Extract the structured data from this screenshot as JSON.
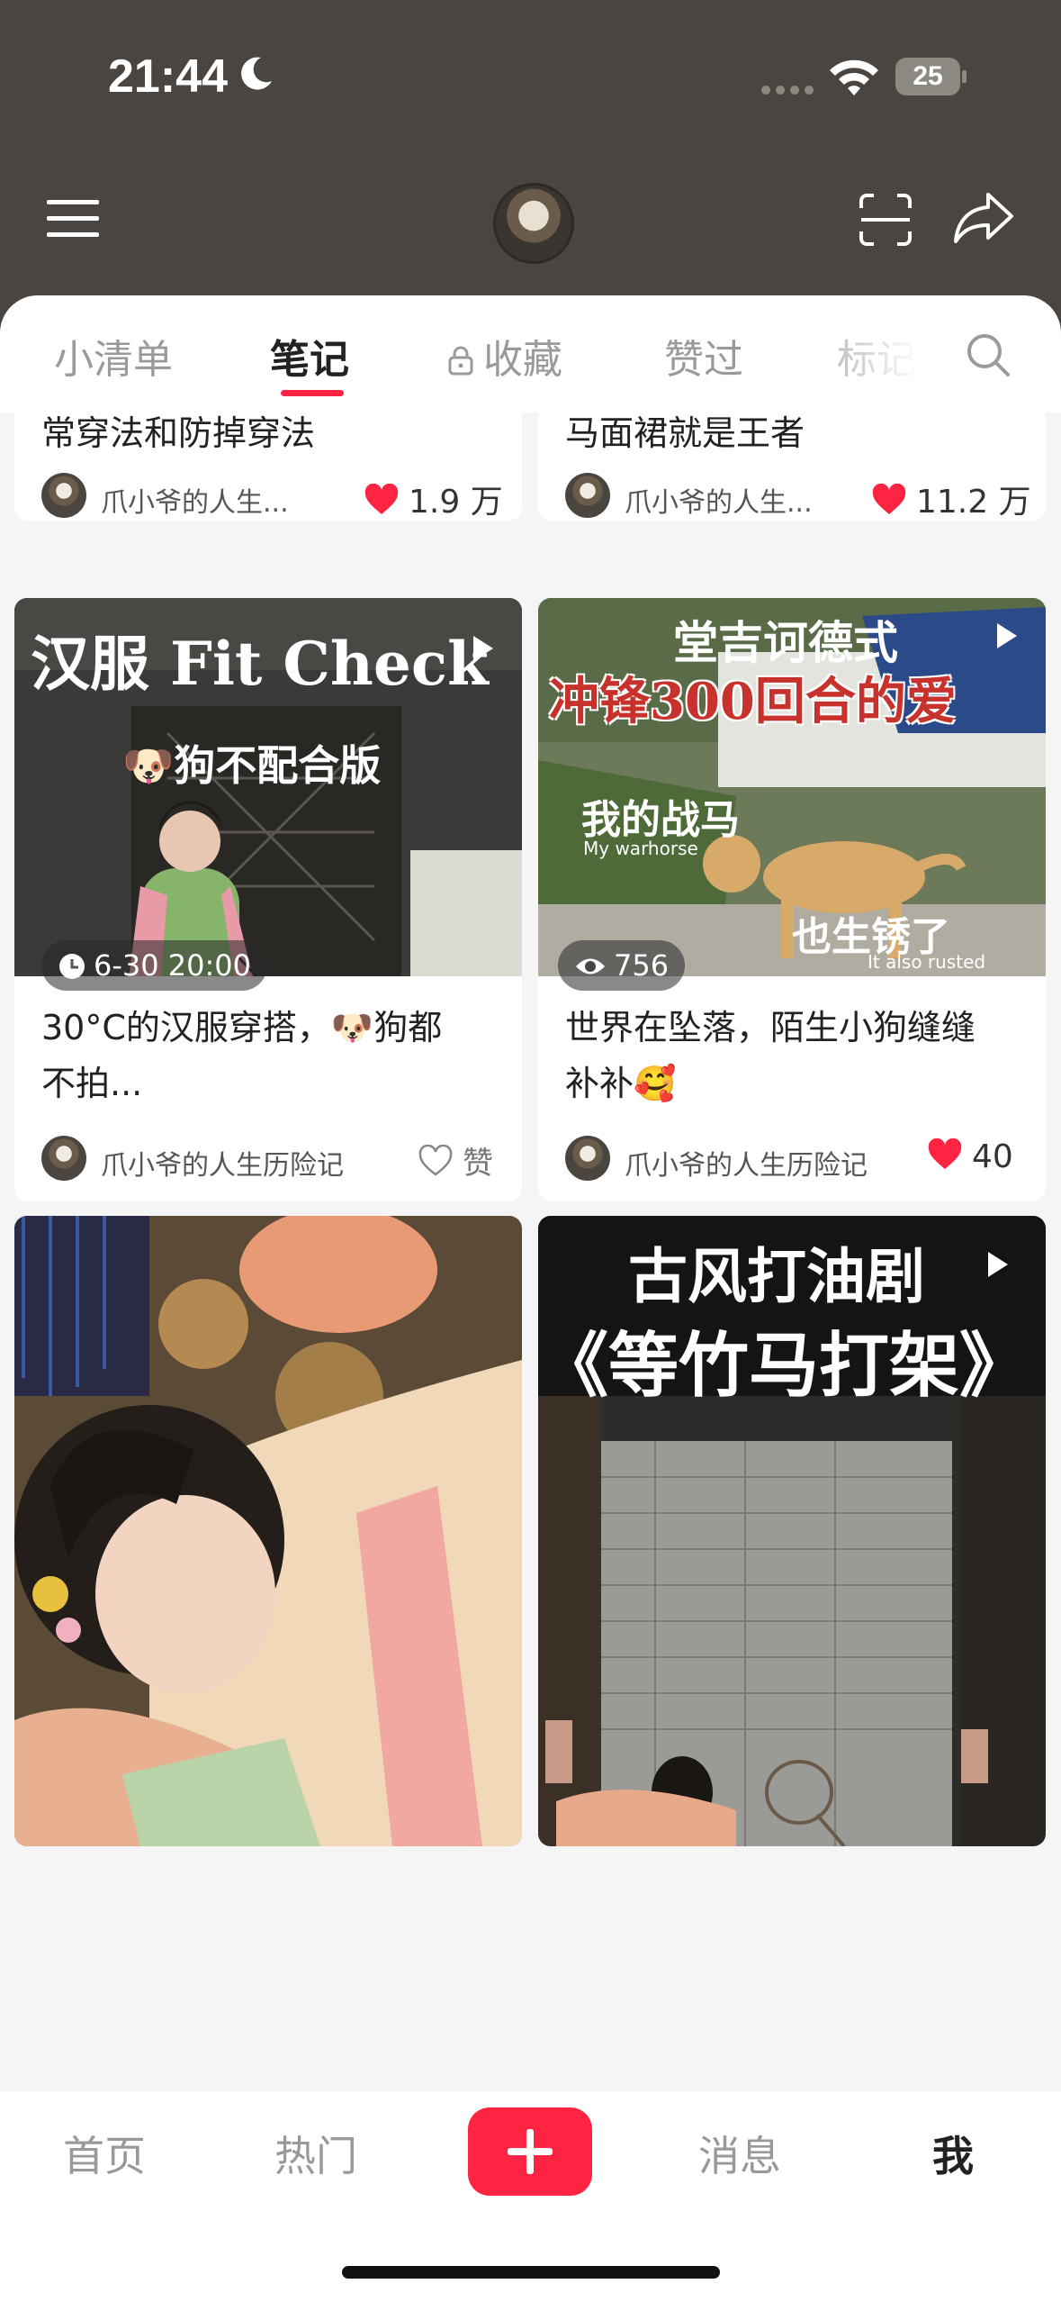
{
  "status": {
    "time": "21:44",
    "battery": "25"
  },
  "tabs": [
    {
      "label": "小清单"
    },
    {
      "label": "笔记"
    },
    {
      "label": "收藏"
    },
    {
      "label": "赞过"
    },
    {
      "label": "标记"
    }
  ],
  "cards_top": [
    {
      "title_line": "常穿法和防掉穿法",
      "author": "爪小爷的人生...",
      "likes": "1.9 万"
    },
    {
      "title_line": "马面裙就是王者",
      "author": "爪小爷的人生...",
      "likes": "11.2 万"
    }
  ],
  "cards_mid": [
    {
      "overlay_title": "汉服 Fit Check",
      "overlay_sub": "🐶狗不配合版",
      "badge": "6-30 20:00",
      "title1": "30°C的汉服穿搭，🐶狗都",
      "title2": "不拍...",
      "author": "爪小爷的人生历险记",
      "likes": "赞"
    },
    {
      "overlay_title": "堂吉诃德式",
      "overlay_sub": "冲锋300回合的爱",
      "overlay_mid": "我的战马",
      "overlay_mid_en": "My warhorse",
      "overlay_low": "也生锈了",
      "overlay_low_en": "It also rusted",
      "badge": "756",
      "title1": "世界在坠落，陌生小狗缝缝",
      "title2": "补补🥰",
      "author": "爪小爷的人生历险记",
      "likes": "40"
    }
  ],
  "cards_bottom": [
    {},
    {
      "overlay_title": "古风打油剧",
      "overlay_sub": "《等竹马打架》"
    }
  ],
  "nav": [
    {
      "label": "首页"
    },
    {
      "label": "热门"
    },
    {
      "label": "消息"
    },
    {
      "label": "我"
    }
  ],
  "colors": {
    "accent": "#ff2442",
    "header_bg": "#4a4540"
  }
}
